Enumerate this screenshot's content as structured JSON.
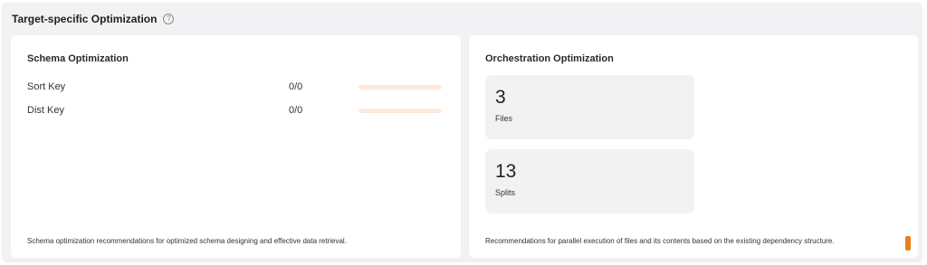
{
  "header": {
    "title": "Target-specific Optimization",
    "help_icon": "?"
  },
  "schema": {
    "title": "Schema Optimization",
    "rows": [
      {
        "label": "Sort Key",
        "value": "0/0",
        "progress": 0
      },
      {
        "label": "Dist Key",
        "value": "0/0",
        "progress": 0
      }
    ],
    "footer": "Schema optimization recommendations for optimized schema designing and effective data retrieval."
  },
  "orchestration": {
    "title": "Orchestration Optimization",
    "stats": [
      {
        "value": "3",
        "label": "Files"
      },
      {
        "value": "13",
        "label": "Splits"
      }
    ],
    "footer": "Recommendations for parallel execution of files and its contents based on the existing dependency structure."
  },
  "colors": {
    "bar_track": "#fde9dc",
    "accent": "#e8801f"
  }
}
